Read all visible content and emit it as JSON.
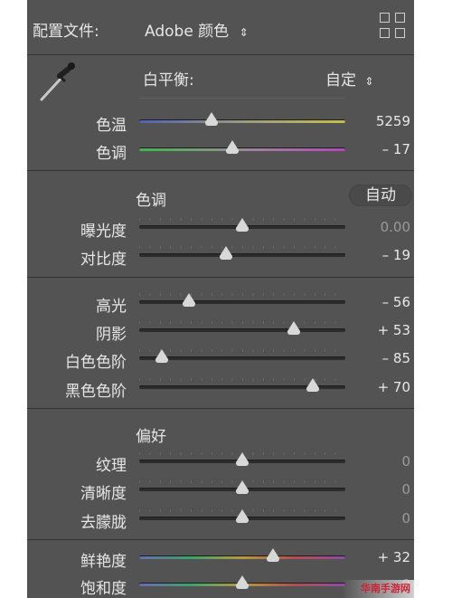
{
  "header": {
    "profile_label": "配置文件:",
    "profile_value": "Adobe 颜色",
    "profile_arrow": "⇕"
  },
  "wb": {
    "label": "白平衡:",
    "value": "自定",
    "arrow": "⇕"
  },
  "temp": {
    "label": "色温",
    "value": "5259",
    "position": 0.35
  },
  "tint": {
    "label": "色调",
    "value": "– 17",
    "position": 0.45
  },
  "tone": {
    "heading": "色调",
    "auto": "自动"
  },
  "exposure": {
    "label": "曝光度",
    "value": "0.00",
    "position": 0.5
  },
  "contrast": {
    "label": "对比度",
    "value": "– 19",
    "position": 0.42
  },
  "highlights": {
    "label": "高光",
    "value": "– 56",
    "position": 0.24
  },
  "shadows": {
    "label": "阴影",
    "value": "+ 53",
    "position": 0.75
  },
  "whites": {
    "label": "白色色阶",
    "value": "– 85",
    "position": 0.11
  },
  "blacks": {
    "label": "黑色色阶",
    "value": "+ 70",
    "position": 0.84
  },
  "presence": {
    "heading": "偏好"
  },
  "texture": {
    "label": "纹理",
    "value": "0",
    "position": 0.5
  },
  "clarity": {
    "label": "清晰度",
    "value": "0",
    "position": 0.5
  },
  "dehaze": {
    "label": "去朦胧",
    "value": "0",
    "position": 0.5
  },
  "vibrance": {
    "label": "鲜艳度",
    "value": "+ 32",
    "position": 0.65
  },
  "saturation": {
    "label": "饱和度",
    "value": "0",
    "position": 0.5
  },
  "watermark": "华南手游网",
  "colors": {
    "panel": "#535353",
    "text": "#e6e6e6",
    "divider": "#333333"
  }
}
